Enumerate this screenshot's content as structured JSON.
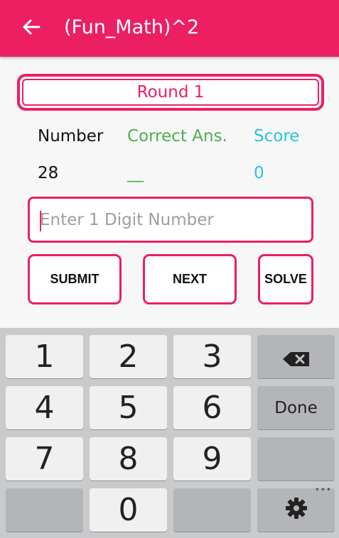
{
  "app_bar": {
    "title": "(Fun_Math)^2",
    "back_icon": "arrow-left-icon",
    "color": "#ec1f63"
  },
  "round": {
    "label": "Round 1"
  },
  "stats": {
    "number_header": "Number",
    "correct_header": "Correct Ans.",
    "score_header": "Score",
    "number_value": "28",
    "correct_value": "__",
    "score_value": "0"
  },
  "input": {
    "placeholder": "Enter 1 Digit Number",
    "value": ""
  },
  "buttons": {
    "submit": "SUBMIT",
    "next": "NEXT",
    "solve": "SOLVE"
  },
  "keyboard": {
    "keys": [
      "1",
      "2",
      "3",
      "4",
      "5",
      "6",
      "7",
      "8",
      "9",
      "0"
    ],
    "done": "Done",
    "backspace_icon": "backspace-icon",
    "settings_icon": "gear-icon",
    "more_icon": "more-dots-icon"
  },
  "colors": {
    "accent": "#ec1f63",
    "green": "#4caf50",
    "cyan": "#26c6da"
  }
}
